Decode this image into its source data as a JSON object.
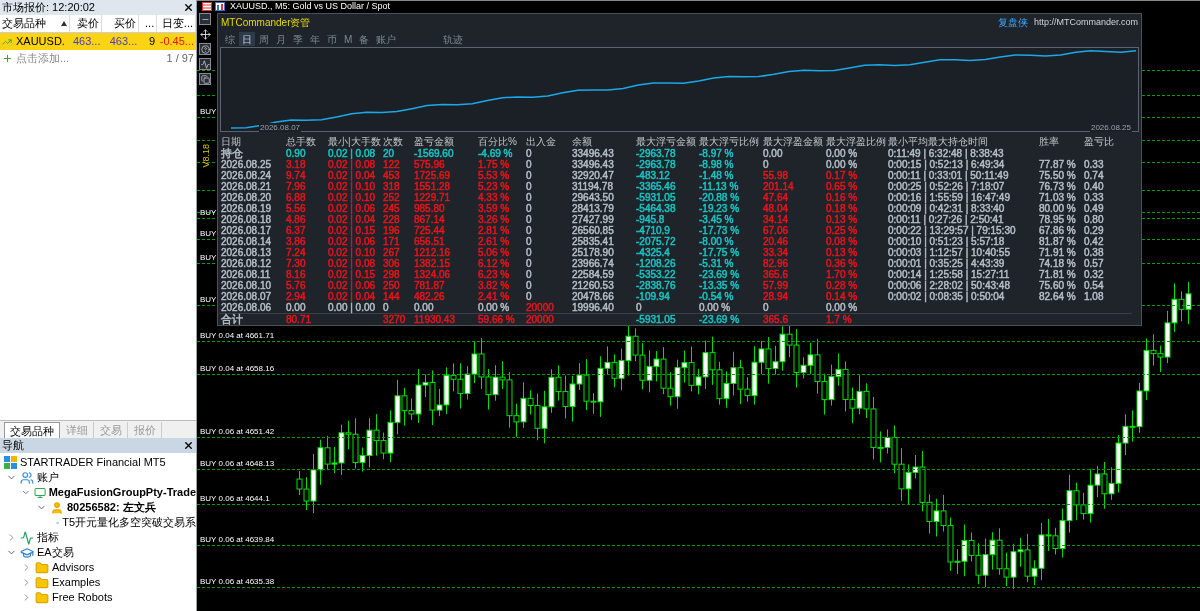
{
  "market_watch": {
    "title": "市场报价: 12:20:02",
    "columns": [
      "交易品种",
      "卖价",
      "买价",
      "...",
      "日变..."
    ],
    "rows": [
      {
        "cells": [
          "XAUUSD.",
          "463...",
          "463...",
          "9",
          "-0.45..."
        ],
        "selected": true
      }
    ],
    "add_hint": "点击添加...",
    "count": "1 / 97"
  },
  "panel_tabs": [
    {
      "label": "交易品种",
      "selected": true
    },
    {
      "label": "详细",
      "selected": false
    },
    {
      "label": "交易",
      "selected": false
    },
    {
      "label": "报价",
      "selected": false
    }
  ],
  "navigator": {
    "title": "导航",
    "tree": [
      {
        "label": "STARTRADER Financial MT5",
        "kind": "broker",
        "children": [
          {
            "label": "账户",
            "kind": "accounts",
            "expanded": true,
            "children": [
              {
                "label": "MegaFusionGroupPty-Trade",
                "kind": "server",
                "expanded": true,
                "children": [
                  {
                    "label": "80256582: 左文兵",
                    "kind": "user",
                    "expanded": true,
                    "children": [
                      {
                        "label": "T5开元量化多空突破交易系",
                        "kind": "expert"
                      }
                    ]
                  }
                ]
              }
            ]
          },
          {
            "label": "指标",
            "kind": "indicators",
            "expanded": false
          },
          {
            "label": "EA交易",
            "kind": "expert",
            "expanded": true,
            "children": [
              {
                "label": "Advisors",
                "kind": "folder",
                "expanded": false
              },
              {
                "label": "Examples",
                "kind": "folder",
                "expanded": false
              },
              {
                "label": "Free Robots",
                "kind": "folder",
                "expanded": false
              }
            ]
          }
        ]
      }
    ]
  },
  "chart": {
    "title": "XAUUSD., M5: Gold vs US Dollar / Spot",
    "version": "V8.18",
    "order_lines": [
      "BUY",
      "BUY",
      "BUY",
      "BUY",
      "BUY",
      "BUY 0.04 at 4661.71",
      "BUY 0.04 at 4658.16",
      "BUY 0.06 at 4651.42",
      "BUY 0.06 at 4648.13",
      "BUY 0.06 at 4644.1",
      "BUY 0.06 at 4639.84",
      "BUY 0.06 at 4635.38"
    ]
  },
  "commander": {
    "title": "MTCommander资管",
    "brand": "复盘侠",
    "url": "http://MTCommander.com",
    "tabs": [
      {
        "label": "综",
        "selected": false
      },
      {
        "label": "日",
        "selected": true
      },
      {
        "label": "周",
        "selected": false
      },
      {
        "label": "月",
        "selected": false
      },
      {
        "label": "季",
        "selected": false
      },
      {
        "label": "年",
        "selected": false
      },
      {
        "label": "币",
        "selected": false
      },
      {
        "label": "M",
        "selected": false
      },
      {
        "label": "备",
        "selected": false
      },
      {
        "label": "账户",
        "selected": false
      },
      {
        "label": "轨迹",
        "selected": false
      }
    ],
    "curve": {
      "start_label": "2026.08.07",
      "end_label": "2026.08.25"
    },
    "table": {
      "columns": [
        "日期",
        "总手数",
        "最小|大手数",
        "次数",
        "盈亏金额",
        "百分比%",
        "出入金",
        "余额",
        "最大浮亏金额",
        "最大浮亏比例",
        "最大浮盈金额",
        "最大浮盈比例",
        "最小平均最大持仓时间",
        "胜率",
        "盈亏比"
      ],
      "rows": [
        {
          "kind": "position",
          "cells": [
            "持仓",
            {
              "text": "0.90",
              "color": "#19c3c0"
            },
            {
              "text": "0.02 | 0.08",
              "color": "#19c3c0"
            },
            {
              "text": "20",
              "color": "#19c3c0"
            },
            {
              "text": "-1569.60",
              "color": "#19c3c0"
            },
            {
              "text": "-4.69 %",
              "color": "#19c3c0"
            },
            "0",
            "33496.43",
            {
              "text": "-2963.78",
              "color": "#19c3c0"
            },
            {
              "text": "-8.97 %",
              "color": "#19c3c0"
            },
            "0.00",
            "0.00 %",
            "0:11:49 | 6:32:48 | 8:38:43"
          ]
        },
        {
          "kind": "day",
          "cells": [
            "2026.08.25",
            {
              "text": "3.18",
              "color": "#e8131b"
            },
            {
              "text": "0.02 | 0.08",
              "color": "#e8131b"
            },
            {
              "text": "122",
              "color": "#e8131b"
            },
            {
              "text": "575.96",
              "color": "#e8131b"
            },
            {
              "text": "1.75 %",
              "color": "#e8131b"
            },
            "0",
            "33496.43",
            {
              "text": "-2963.78",
              "color": "#19c3c0"
            },
            {
              "text": "-8.98 %",
              "color": "#19c3c0"
            },
            "0",
            "0.00 %",
            "0:00:15 | 0:52:13 | 6:49:34",
            "77.87 %",
            "0.33"
          ]
        },
        {
          "kind": "day",
          "cells": [
            "2026.08.24",
            {
              "text": "9.74",
              "color": "#e8131b"
            },
            {
              "text": "0.02 | 0.04",
              "color": "#e8131b"
            },
            {
              "text": "453",
              "color": "#e8131b"
            },
            {
              "text": "1725.69",
              "color": "#e8131b"
            },
            {
              "text": "5.53 %",
              "color": "#e8131b"
            },
            "0",
            "32920.47",
            {
              "text": "-483.12",
              "color": "#19c3c0"
            },
            {
              "text": "-1.48 %",
              "color": "#19c3c0"
            },
            {
              "text": "55.98",
              "color": "#e8131b"
            },
            {
              "text": "0.17 %",
              "color": "#e8131b"
            },
            "0:00:11 | 0:33:01 | 50:11:49",
            "75.50 %",
            "0.74"
          ]
        },
        {
          "kind": "day",
          "cells": [
            "2026.08.21",
            {
              "text": "7.96",
              "color": "#e8131b"
            },
            {
              "text": "0.02 | 0.10",
              "color": "#e8131b"
            },
            {
              "text": "318",
              "color": "#e8131b"
            },
            {
              "text": "1551.28",
              "color": "#e8131b"
            },
            {
              "text": "5.23 %",
              "color": "#e8131b"
            },
            "0",
            "31194.78",
            {
              "text": "-3365.46",
              "color": "#19c3c0"
            },
            {
              "text": "-11.13 %",
              "color": "#19c3c0"
            },
            {
              "text": "201.14",
              "color": "#e8131b"
            },
            {
              "text": "0.65 %",
              "color": "#e8131b"
            },
            "0:00:25 | 0:52:26 | 7:18:07",
            "76.73 %",
            "0.40"
          ]
        },
        {
          "kind": "day",
          "cells": [
            "2026.08.20",
            {
              "text": "6.88",
              "color": "#e8131b"
            },
            {
              "text": "0.02 | 0.10",
              "color": "#e8131b"
            },
            {
              "text": "252",
              "color": "#e8131b"
            },
            {
              "text": "1229.71",
              "color": "#e8131b"
            },
            {
              "text": "4.33 %",
              "color": "#e8131b"
            },
            "0",
            "29643.50",
            {
              "text": "-5931.05",
              "color": "#19c3c0"
            },
            {
              "text": "-20.88 %",
              "color": "#19c3c0"
            },
            {
              "text": "47.64",
              "color": "#e8131b"
            },
            {
              "text": "0.16 %",
              "color": "#e8131b"
            },
            "0:00:16 | 1:55:59 | 16:47:49",
            "71.03 %",
            "0.33"
          ]
        },
        {
          "kind": "day",
          "cells": [
            "2026.08.19",
            {
              "text": "5.56",
              "color": "#e8131b"
            },
            {
              "text": "0.02 | 0.06",
              "color": "#e8131b"
            },
            {
              "text": "245",
              "color": "#e8131b"
            },
            {
              "text": "985.80",
              "color": "#e8131b"
            },
            {
              "text": "3.59 %",
              "color": "#e8131b"
            },
            "0",
            "28413.79",
            {
              "text": "-5464.38",
              "color": "#19c3c0"
            },
            {
              "text": "-19.23 %",
              "color": "#19c3c0"
            },
            {
              "text": "48.04",
              "color": "#e8131b"
            },
            {
              "text": "0.18 %",
              "color": "#e8131b"
            },
            "0:00:09 | 0:42:31 | 8:33:40",
            "80.00 %",
            "0.49"
          ]
        },
        {
          "kind": "day",
          "cells": [
            "2026.08.18",
            {
              "text": "4.86",
              "color": "#e8131b"
            },
            {
              "text": "0.02 | 0.04",
              "color": "#e8131b"
            },
            {
              "text": "228",
              "color": "#e8131b"
            },
            {
              "text": "867.14",
              "color": "#e8131b"
            },
            {
              "text": "3.26 %",
              "color": "#e8131b"
            },
            "0",
            "27427.99",
            {
              "text": "-945.8",
              "color": "#19c3c0"
            },
            {
              "text": "-3.45 %",
              "color": "#19c3c0"
            },
            {
              "text": "34.14",
              "color": "#e8131b"
            },
            {
              "text": "0.13 %",
              "color": "#e8131b"
            },
            "0:00:11 | 0:27:26 | 2:50:41",
            "78.95 %",
            "0.80"
          ]
        },
        {
          "kind": "day",
          "cells": [
            "2026.08.17",
            {
              "text": "6.37",
              "color": "#e8131b"
            },
            {
              "text": "0.02 | 0.15",
              "color": "#e8131b"
            },
            {
              "text": "196",
              "color": "#e8131b"
            },
            {
              "text": "725.44",
              "color": "#e8131b"
            },
            {
              "text": "2.81 %",
              "color": "#e8131b"
            },
            "0",
            "26560.85",
            {
              "text": "-4710.9",
              "color": "#19c3c0"
            },
            {
              "text": "-17.73 %",
              "color": "#19c3c0"
            },
            {
              "text": "67.06",
              "color": "#e8131b"
            },
            {
              "text": "0.25 %",
              "color": "#e8131b"
            },
            "0:00:22 | 13:29:57 | 79:15:30",
            "67.86 %",
            "0.29"
          ]
        },
        {
          "kind": "day",
          "cells": [
            "2026.08.14",
            {
              "text": "3.86",
              "color": "#e8131b"
            },
            {
              "text": "0.02 | 0.06",
              "color": "#e8131b"
            },
            {
              "text": "171",
              "color": "#e8131b"
            },
            {
              "text": "656.51",
              "color": "#e8131b"
            },
            {
              "text": "2.61 %",
              "color": "#e8131b"
            },
            "0",
            "25835.41",
            {
              "text": "-2075.72",
              "color": "#19c3c0"
            },
            {
              "text": "-8.00 %",
              "color": "#19c3c0"
            },
            {
              "text": "20.46",
              "color": "#e8131b"
            },
            {
              "text": "0.08 %",
              "color": "#e8131b"
            },
            "0:00:10 | 0:51:23 | 5:57:18",
            "81.87 %",
            "0.42"
          ]
        },
        {
          "kind": "day",
          "cells": [
            "2026.08.13",
            {
              "text": "7.24",
              "color": "#e8131b"
            },
            {
              "text": "0.02 | 0.10",
              "color": "#e8131b"
            },
            {
              "text": "267",
              "color": "#e8131b"
            },
            {
              "text": "1212.16",
              "color": "#e8131b"
            },
            {
              "text": "5.06 %",
              "color": "#e8131b"
            },
            "0",
            "25178.90",
            {
              "text": "-4325.4",
              "color": "#19c3c0"
            },
            {
              "text": "-17.75 %",
              "color": "#19c3c0"
            },
            {
              "text": "33.34",
              "color": "#e8131b"
            },
            {
              "text": "0.13 %",
              "color": "#e8131b"
            },
            "0:00:03 | 1:12:57 | 10:40:55",
            "71.91 %",
            "0.38"
          ]
        },
        {
          "kind": "day",
          "cells": [
            "2026.08.12",
            {
              "text": "7.30",
              "color": "#e8131b"
            },
            {
              "text": "0.02 | 0.08",
              "color": "#e8131b"
            },
            {
              "text": "306",
              "color": "#e8131b"
            },
            {
              "text": "1382.15",
              "color": "#e8131b"
            },
            {
              "text": "6.12 %",
              "color": "#e8131b"
            },
            "0",
            "23966.74",
            {
              "text": "-1208.26",
              "color": "#19c3c0"
            },
            {
              "text": "-5.31 %",
              "color": "#19c3c0"
            },
            {
              "text": "82.96",
              "color": "#e8131b"
            },
            {
              "text": "0.36 %",
              "color": "#e8131b"
            },
            "0:00:01 | 0:35:25 | 4:43:39",
            "74.18 %",
            "0.57"
          ]
        },
        {
          "kind": "day",
          "cells": [
            "2026.08.11",
            {
              "text": "8.16",
              "color": "#e8131b"
            },
            {
              "text": "0.02 | 0.15",
              "color": "#e8131b"
            },
            {
              "text": "298",
              "color": "#e8131b"
            },
            {
              "text": "1324.06",
              "color": "#e8131b"
            },
            {
              "text": "6.23 %",
              "color": "#e8131b"
            },
            "0",
            "22584.59",
            {
              "text": "-5353.22",
              "color": "#19c3c0"
            },
            {
              "text": "-23.69 %",
              "color": "#19c3c0"
            },
            {
              "text": "365.6",
              "color": "#e8131b"
            },
            {
              "text": "1.70 %",
              "color": "#e8131b"
            },
            "0:00:14 | 1:25:58 | 15:27:11",
            "71.81 %",
            "0.32"
          ]
        },
        {
          "kind": "day",
          "cells": [
            "2026.08.10",
            {
              "text": "5.76",
              "color": "#e8131b"
            },
            {
              "text": "0.02 | 0.06",
              "color": "#e8131b"
            },
            {
              "text": "250",
              "color": "#e8131b"
            },
            {
              "text": "781.87",
              "color": "#e8131b"
            },
            {
              "text": "3.82 %",
              "color": "#e8131b"
            },
            "0",
            "21260.53",
            {
              "text": "-2838.76",
              "color": "#19c3c0"
            },
            {
              "text": "-13.35 %",
              "color": "#19c3c0"
            },
            {
              "text": "57.99",
              "color": "#e8131b"
            },
            {
              "text": "0.28 %",
              "color": "#e8131b"
            },
            "0:00:06 | 2:28:02 | 50:43:48",
            "75.60 %",
            "0.54"
          ]
        },
        {
          "kind": "day",
          "cells": [
            "2026.08.07",
            {
              "text": "2.94",
              "color": "#e8131b"
            },
            {
              "text": "0.02 | 0.04",
              "color": "#e8131b"
            },
            {
              "text": "144",
              "color": "#e8131b"
            },
            {
              "text": "482.26",
              "color": "#e8131b"
            },
            {
              "text": "2.41 %",
              "color": "#e8131b"
            },
            "0",
            "20478.66",
            {
              "text": "-109.94",
              "color": "#19c3c0"
            },
            {
              "text": "-0.54 %",
              "color": "#19c3c0"
            },
            {
              "text": "28.94",
              "color": "#e8131b"
            },
            {
              "text": "0.14 %",
              "color": "#e8131b"
            },
            "0:00:02 | 0:08:35 | 0:50:04",
            "82.64 %",
            "1.08"
          ]
        },
        {
          "kind": "day",
          "cells": [
            "2026.08.06",
            "0.00",
            "0.00 | 0.00",
            "0",
            "0.00",
            "0.00 %",
            {
              "text": "20000",
              "color": "#e8131b"
            },
            "19996.40",
            "0",
            "0.00 %",
            "0",
            "0.00 %"
          ]
        },
        {
          "kind": "total",
          "cells": [
            "合计",
            {
              "text": "80.71",
              "color": "#e8131b"
            },
            null,
            {
              "text": "3270",
              "color": "#e8131b"
            },
            {
              "text": "11930.43",
              "color": "#e8131b"
            },
            {
              "text": "59.66 %",
              "color": "#e8131b"
            },
            {
              "text": "20000",
              "color": "#e8131b"
            },
            null,
            {
              "text": "-5931.05",
              "color": "#19c3c0"
            },
            {
              "text": "-23.69 %",
              "color": "#19c3c0"
            },
            {
              "text": "365.6",
              "color": "#e8131b"
            },
            {
              "text": "1.7 %",
              "color": "#e8131b"
            }
          ]
        }
      ]
    }
  }
}
